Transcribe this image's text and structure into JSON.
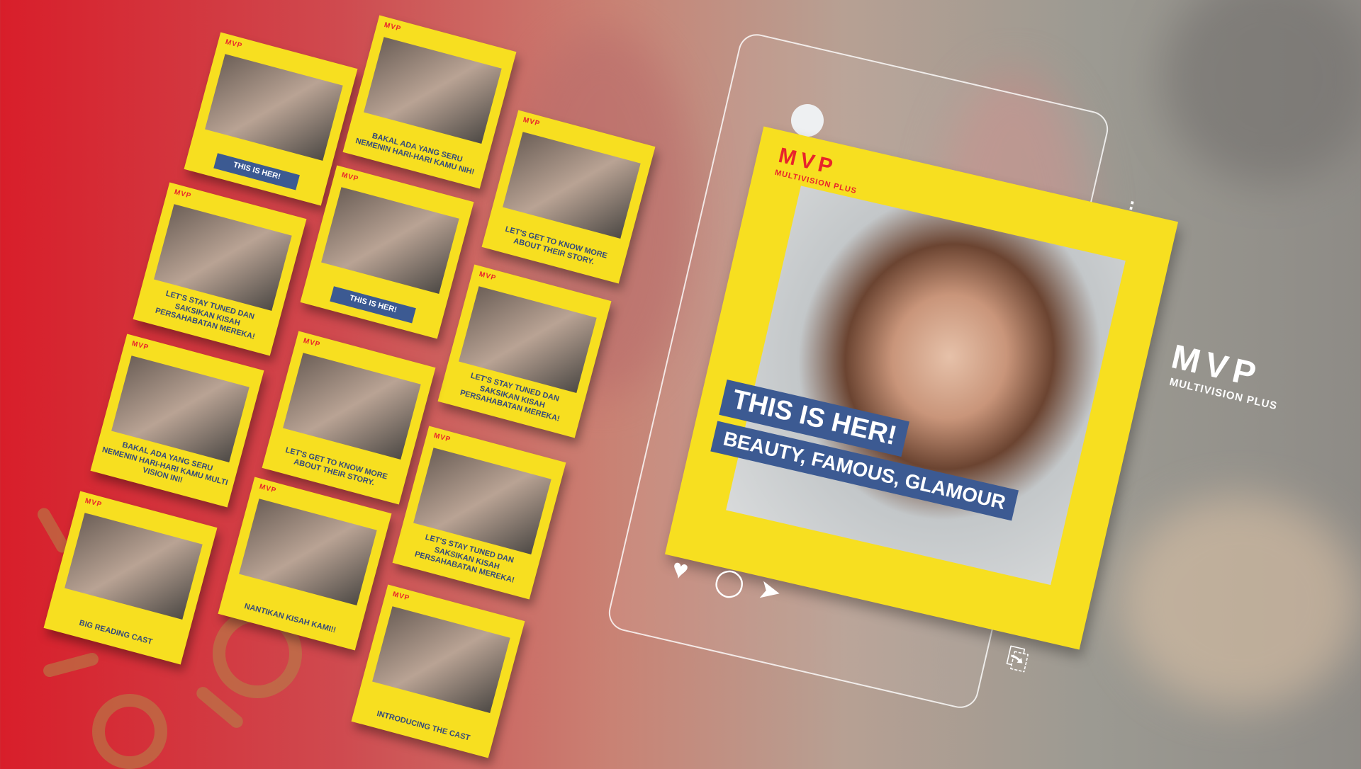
{
  "brand": {
    "logo": "MVP",
    "name": "MULTIVISION PLUS"
  },
  "main_post": {
    "headline": "THIS IS HER!",
    "subline": "BEAUTY, FAMOUS, GLAMOUR",
    "icons": {
      "like": "heart-icon",
      "comment": "comment-icon",
      "share": "send-icon",
      "save": "bookmark-icon",
      "menu": "more-dots-icon"
    }
  },
  "cards": [
    {
      "logo": "MVP",
      "caption": "THIS IS HER!"
    },
    {
      "logo": "MVP",
      "caption": "BAKAL ADA YANG SERU NEMENIN HARI-HARI KAMU NIH!"
    },
    {
      "logo": "MVP",
      "caption": "LET'S GET TO KNOW MORE ABOUT THEIR STORY."
    },
    {
      "logo": "MVP",
      "caption": "Let's Stay Tuned DAN SAKSIKAN KISAH PERSAHABATAN MEREKA!"
    },
    {
      "logo": "MVP",
      "caption": "THIS IS HER!"
    },
    {
      "logo": "MVP",
      "caption": "Let's Stay Tuned DAN SAKSIKAN KISAH PERSAHABATAN MEREKA!"
    },
    {
      "logo": "MVP",
      "caption": "BAKAL ADA YANG SERU NEMENIN HARI-HARI KAMU Multi Vision ini!"
    },
    {
      "logo": "MVP",
      "caption": "LET'S GET TO KNOW MORE ABOUT THEIR STORY."
    },
    {
      "logo": "MVP",
      "caption": "Let's Stay Tuned DAN SAKSIKAN KISAH PERSAHABATAN MEREKA!"
    },
    {
      "logo": "MVP",
      "caption": "BIG READING CAST"
    },
    {
      "logo": "MVP",
      "caption": "NANTIKAN KISAH KAMI!!"
    },
    {
      "logo": "MVP",
      "caption": "INTRODUCING THE CAST"
    }
  ]
}
